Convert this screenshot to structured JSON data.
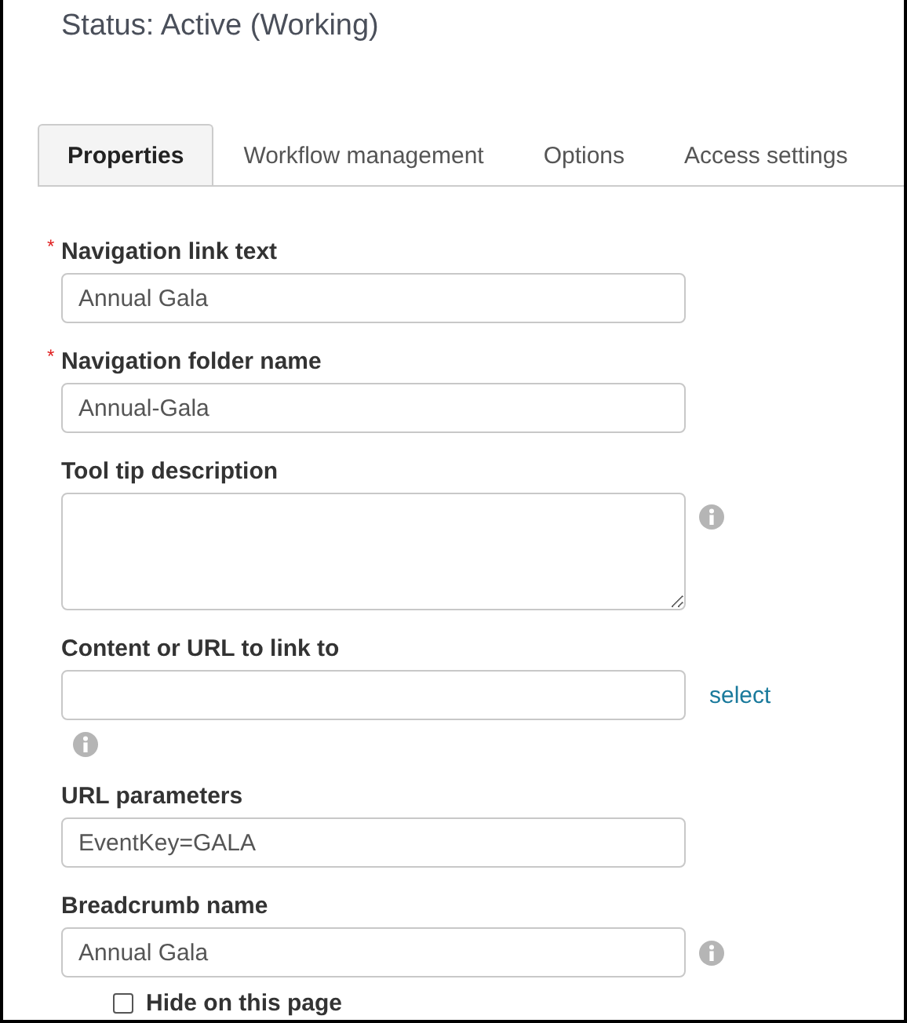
{
  "status_title": "Status: Active (Working)",
  "tabs": [
    {
      "label": "Properties",
      "selected": true
    },
    {
      "label": "Workflow management",
      "selected": false
    },
    {
      "label": "Options",
      "selected": false
    },
    {
      "label": "Access settings",
      "selected": false
    }
  ],
  "fields": [
    {
      "kind": "text",
      "label": "Navigation link text",
      "required_mark": "*",
      "value": "Annual Gala"
    },
    {
      "kind": "text",
      "label": "Navigation folder name",
      "required_mark": "*",
      "value": "Annual-Gala"
    },
    {
      "kind": "textarea",
      "label": "Tool tip description",
      "info": true
    },
    {
      "kind": "url",
      "label": "Content or URL to link to",
      "link": "select",
      "info": true
    },
    {
      "kind": "text",
      "label": "URL parameters",
      "value": "EventKey=GALA"
    },
    {
      "kind": "text",
      "label": "Breadcrumb name",
      "value": "Annual Gala",
      "info": true
    }
  ],
  "hide_checkbox": {
    "label": "Hide on this page",
    "checked": false
  }
}
